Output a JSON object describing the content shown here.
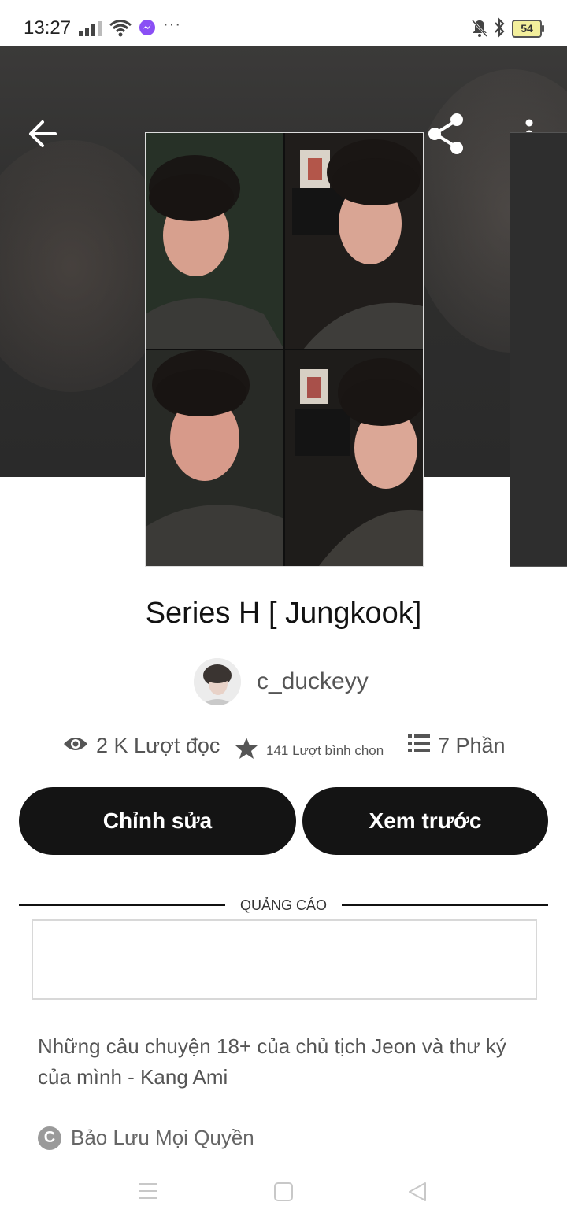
{
  "status_bar": {
    "time": "13:27",
    "battery": "54",
    "more": "···"
  },
  "hero": {
    "back_icon": "arrow-left-icon",
    "share_icon": "share-icon",
    "menu_icon": "more-vertical-icon"
  },
  "story": {
    "title": "Series H [ Jungkook]",
    "author": "c_duckeyy",
    "stats": {
      "reads": "2 K Lượt đọc",
      "votes": "141 Lượt bình chọn",
      "parts": "7 Phần"
    },
    "buttons": {
      "edit": "Chỉnh sửa",
      "preview": "Xem trước"
    },
    "ad_label": "QUẢNG CÁO",
    "description": "Những câu chuyện 18+ của chủ tịch Jeon và thư ký của mình - Kang Ami",
    "copyright": "Bảo Lưu Mọi Quyền"
  },
  "colors": {
    "button_bg": "#141414",
    "hero_bg": "#2f2f2e"
  }
}
